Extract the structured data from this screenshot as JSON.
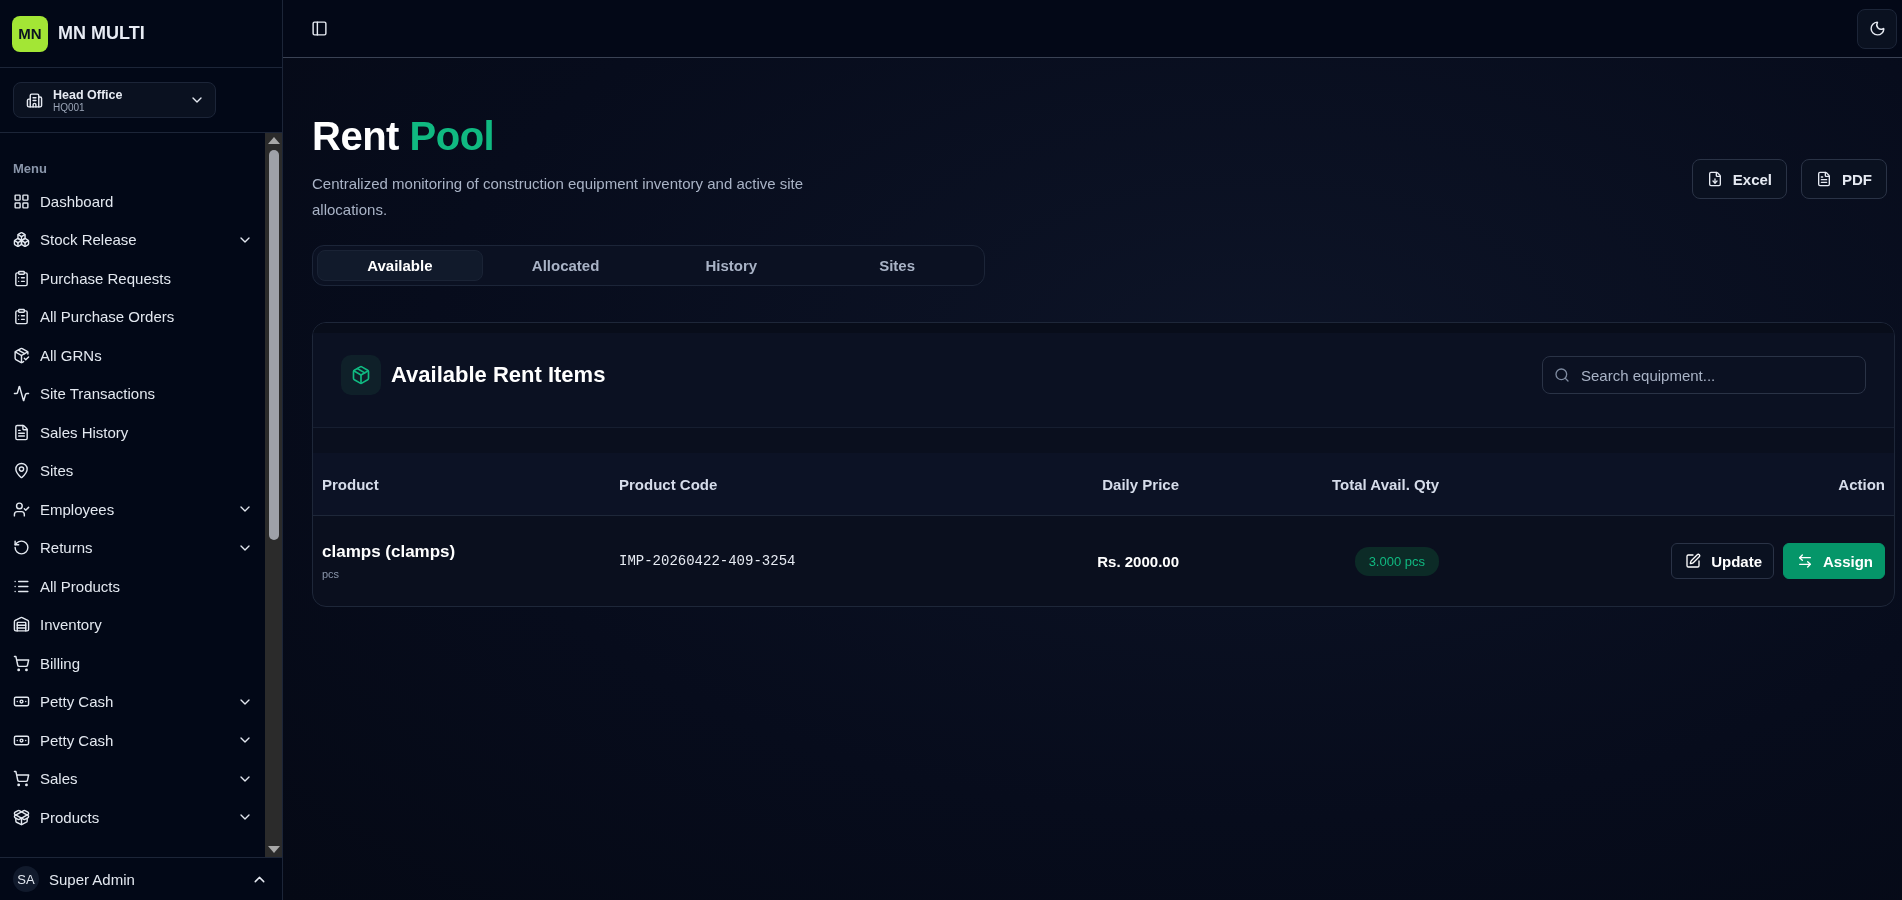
{
  "brand": {
    "logo": "MN",
    "name": "MN MULTI"
  },
  "branch": {
    "name": "Head Office",
    "code": "HQ001"
  },
  "menu_label": "Menu",
  "sidebar": {
    "items": [
      {
        "label": "Dashboard",
        "has_submenu": false
      },
      {
        "label": "Stock Release",
        "has_submenu": true
      },
      {
        "label": "Purchase Requests",
        "has_submenu": false
      },
      {
        "label": "All Purchase Orders",
        "has_submenu": false
      },
      {
        "label": "All GRNs",
        "has_submenu": false
      },
      {
        "label": "Site Transactions",
        "has_submenu": false
      },
      {
        "label": "Sales History",
        "has_submenu": false
      },
      {
        "label": "Sites",
        "has_submenu": false
      },
      {
        "label": "Employees",
        "has_submenu": true
      },
      {
        "label": "Returns",
        "has_submenu": true
      },
      {
        "label": "All Products",
        "has_submenu": false
      },
      {
        "label": "Inventory",
        "has_submenu": false
      },
      {
        "label": "Billing",
        "has_submenu": false
      },
      {
        "label": "Petty Cash",
        "has_submenu": true
      },
      {
        "label": "Petty Cash",
        "has_submenu": true
      },
      {
        "label": "Sales",
        "has_submenu": true
      },
      {
        "label": "Products",
        "has_submenu": true
      }
    ]
  },
  "user": {
    "initials": "SA",
    "name": "Super Admin"
  },
  "page": {
    "title_part1": "Rent",
    "title_part2": "Pool",
    "subtitle": "Centralized monitoring of construction equipment inventory and active site allocations.",
    "export_buttons": [
      "Excel",
      "PDF"
    ]
  },
  "tabs": [
    {
      "label": "Available",
      "selected": true
    },
    {
      "label": "Allocated",
      "selected": false
    },
    {
      "label": "History",
      "selected": false
    },
    {
      "label": "Sites",
      "selected": false
    }
  ],
  "card": {
    "title": "Available Rent Items",
    "search": {
      "placeholder": "Search equipment..."
    }
  },
  "table": {
    "columns": [
      "Product",
      "Product Code",
      "Daily Price",
      "Total Avail. Qty",
      "Action"
    ],
    "rows": [
      {
        "product": "clamps (clamps)",
        "unit": "pcs",
        "code": "IMP-20260422-409-3254",
        "price": "Rs. 2000.00",
        "qty": "3.000 pcs",
        "actions": [
          "Update",
          "Assign"
        ]
      }
    ]
  }
}
